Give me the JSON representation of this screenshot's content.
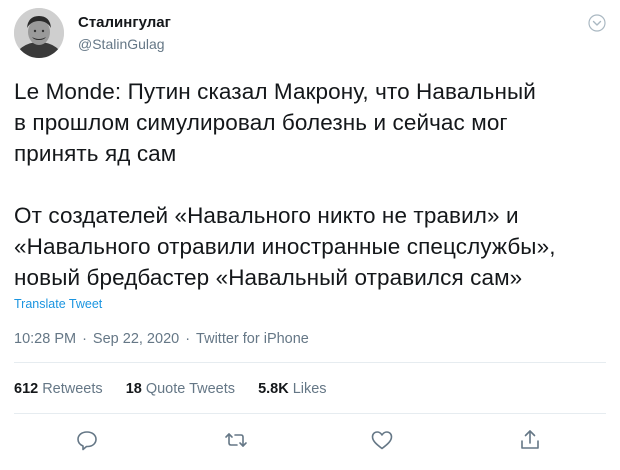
{
  "author": {
    "display_name": "Сталингулаг",
    "handle": "@StalinGulag"
  },
  "tweet": {
    "text": "Le Monde: Путин сказал Макрону, что Навальный\nв прошлом симулировал болезнь и сейчас мог\nпринять яд сам\n\nОт создателей «Навального никто не травил» и\n«Навального отравили иностранные спецслужбы»,\nновый бредбастер «Навальный отравился сам»",
    "translate_label": "Translate Tweet",
    "time": "10:28 PM",
    "date": "Sep 22, 2020",
    "source": "Twitter for iPhone",
    "separator": "·"
  },
  "stats": {
    "retweets": {
      "count": "612",
      "label": "Retweets"
    },
    "quotes": {
      "count": "18",
      "label": "Quote Tweets"
    },
    "likes": {
      "count": "5.8K",
      "label": "Likes"
    }
  },
  "icons": {
    "caret": "chevron-down-icon",
    "reply": "reply-icon",
    "retweet": "retweet-icon",
    "like": "heart-icon",
    "share": "share-icon"
  },
  "colors": {
    "link": "#1b95e0",
    "muted": "#657786",
    "text": "#14171a",
    "divider": "#e6ecf0"
  }
}
